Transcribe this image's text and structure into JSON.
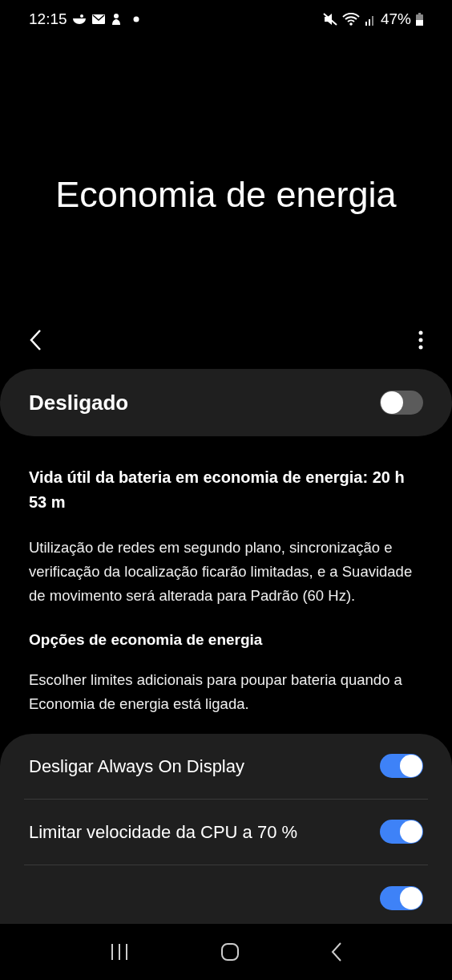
{
  "status_bar": {
    "time": "12:15",
    "battery": "47%"
  },
  "title": "Economia de energia",
  "master": {
    "label": "Desligado",
    "on": false
  },
  "battery_life": "Vida útil da bateria em economia de energia: 20 h 53 m",
  "description": "Utilização de redes em segundo plano, sincronização e verificação da localização ficarão limitadas, e a Suavidade de movimento será alterada para Padrão (60 Hz).",
  "options": {
    "heading": "Opções de economia de energia",
    "text": "Escolher limites adicionais para poupar bateria quando a Economia de energia está ligada.",
    "rows": [
      {
        "label": "Desligar Always On Display",
        "on": true
      },
      {
        "label": "Limitar velocidade da CPU a 70 %",
        "on": true
      },
      {
        "on": true
      }
    ]
  }
}
